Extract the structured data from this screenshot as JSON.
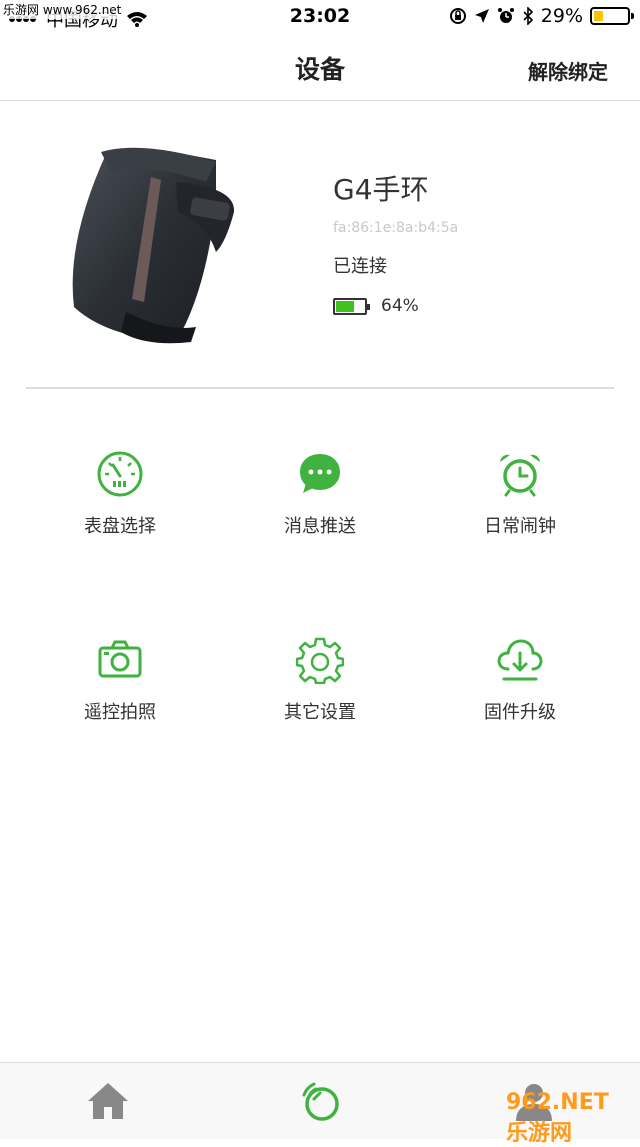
{
  "status_bar": {
    "carrier": "中国移动",
    "time": "23:02",
    "battery_percent": "29%",
    "battery_level": 0.29,
    "watermark": "乐游网 www.962.net"
  },
  "nav": {
    "title": "设备",
    "unbind_label": "解除绑定"
  },
  "device": {
    "name": "G4手环",
    "mac": "fa:86:1e:8a:b4:5a",
    "status": "已连接",
    "battery_text": "64%",
    "battery_level": 0.64
  },
  "features": [
    {
      "label": "表盘选择",
      "icon": "dial-icon"
    },
    {
      "label": "消息推送",
      "icon": "message-icon"
    },
    {
      "label": "日常闹钟",
      "icon": "alarm-clock-icon"
    },
    {
      "label": "遥控拍照",
      "icon": "camera-icon"
    },
    {
      "label": "其它设置",
      "icon": "gear-icon"
    },
    {
      "label": "固件升级",
      "icon": "cloud-download-icon"
    }
  ],
  "tabs": [
    {
      "name": "home",
      "icon": "home-icon"
    },
    {
      "name": "device",
      "icon": "device-icon",
      "active": true
    },
    {
      "name": "profile",
      "icon": "profile-icon"
    }
  ],
  "colors": {
    "accent": "#3fb23f",
    "tab_inactive": "#888888"
  },
  "watermark_bottom": "962.NET 乐游网"
}
